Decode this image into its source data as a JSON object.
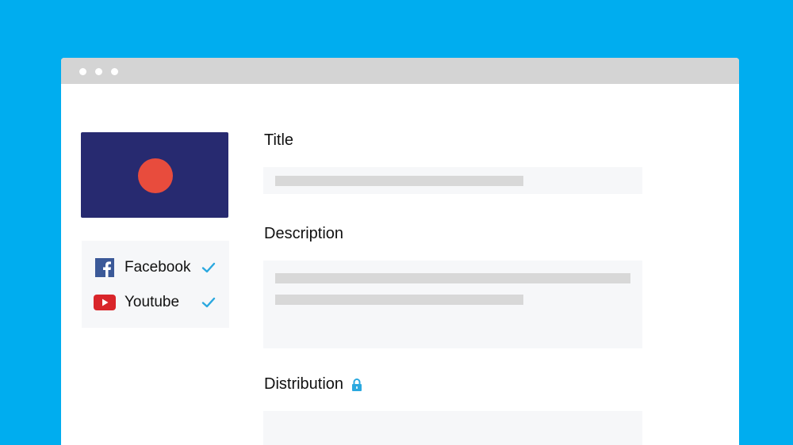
{
  "window": {
    "controls": [
      "dot",
      "dot",
      "dot"
    ]
  },
  "media": {
    "thumbnail_icon": "record-dot-icon",
    "colors": {
      "thumbnail_bg": "#272A70",
      "record_dot": "#E84C3D"
    }
  },
  "platforms": [
    {
      "label": "Facebook",
      "icon": "facebook-icon",
      "checked": true
    },
    {
      "label": "Youtube",
      "icon": "youtube-icon",
      "checked": true
    }
  ],
  "form": {
    "title_label": "Title",
    "description_label": "Description",
    "distribution_label": "Distribution",
    "distribution_icon": "lock-icon"
  },
  "colors": {
    "background": "#00ADEF",
    "check": "#2AA8DF",
    "facebook": "#3B5998",
    "youtube": "#D9252A"
  }
}
